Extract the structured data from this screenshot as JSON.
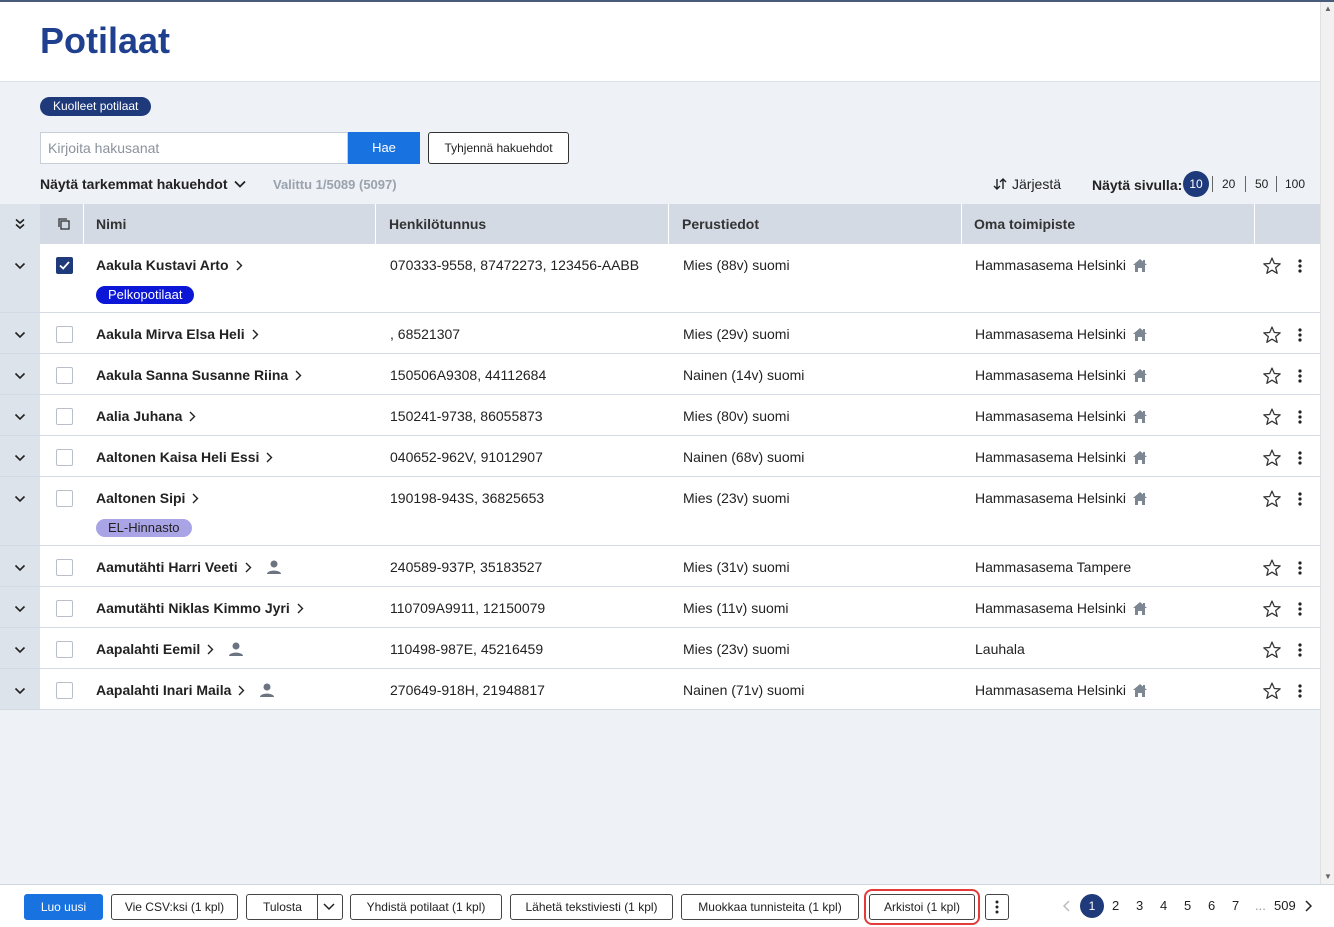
{
  "page": {
    "title": "Potilaat"
  },
  "filters": {
    "deceased_chip": "Kuolleet potilaat",
    "search_placeholder": "Kirjoita hakusanat",
    "search_button": "Hae",
    "clear_button": "Tyhjennä hakuehdot",
    "advanced_toggle": "Näytä tarkemmat hakuehdot",
    "selected_count": "Valittu 1/5089 (5097)",
    "sort_label": "Järjestä",
    "per_page_label": "Näytä sivulla:",
    "per_page_options": [
      "10",
      "20",
      "50",
      "100"
    ],
    "per_page_selected": "10"
  },
  "table": {
    "columns": [
      "Nimi",
      "Henkilötunnus",
      "Perustiedot",
      "Oma toimipiste"
    ],
    "rows": [
      {
        "name": "Aakula Kustavi Arto",
        "hetu": "070333-9558, 87472273, 123456-AABB",
        "basic": "Mies (88v) suomi",
        "office": "Hammasasema Helsinki",
        "tag": "Pelkopotilaat",
        "checked": true
      },
      {
        "name": "Aakula Mirva Elsa Heli",
        "hetu": ", 68521307",
        "basic": "Mies (29v) suomi",
        "office": "Hammasasema Helsinki"
      },
      {
        "name": "Aakula Sanna Susanne Riina",
        "hetu": "150506A9308, 44112684",
        "basic": "Nainen (14v) suomi",
        "office": "Hammasasema Helsinki"
      },
      {
        "name": "Aalia Juhana",
        "hetu": "150241-9738, 86055873",
        "basic": "Mies (80v) suomi",
        "office": "Hammasasema Helsinki"
      },
      {
        "name": "Aaltonen Kaisa Heli Essi",
        "hetu": "040652-962V, 91012907",
        "basic": "Nainen (68v) suomi",
        "office": "Hammasasema Helsinki"
      },
      {
        "name": "Aaltonen Sipi",
        "hetu": "190198-943S, 36825653",
        "basic": "Mies (23v) suomi",
        "office": "Hammasasema Helsinki",
        "tag": "EL-Hinnasto"
      },
      {
        "name": "Aamutähti Harri Veeti",
        "hetu": "240589-937P, 35183527",
        "basic": "Mies (31v) suomi",
        "office": "Hammasasema Tampere"
      },
      {
        "name": "Aamutähti Niklas Kimmo Jyri",
        "hetu": "110709A9911, 12150079",
        "basic": "Mies (11v) suomi",
        "office": "Hammasasema Helsinki"
      },
      {
        "name": "Aapalahti Eemil",
        "hetu": "110498-987E, 45216459",
        "basic": "Mies (23v) suomi",
        "office": "Lauhala"
      },
      {
        "name": "Aapalahti Inari Maila",
        "hetu": "270649-918H, 21948817",
        "basic": "Nainen (71v) suomi",
        "office": "Hammasasema Helsinki"
      }
    ]
  },
  "footer": {
    "create": "Luo uusi",
    "export_csv": "Vie CSV:ksi (1 kpl)",
    "print": "Tulosta",
    "merge": "Yhdistä potilaat (1 kpl)",
    "sms": "Lähetä tekstiviesti (1 kpl)",
    "edit_tags": "Muokkaa tunnisteita (1 kpl)",
    "archive": "Arkistoi (1 kpl)",
    "pages": [
      "1",
      "2",
      "3",
      "4",
      "5",
      "6",
      "7"
    ],
    "ellipsis": "...",
    "last_page": "509"
  },
  "colors": {
    "primary": "#1872e0",
    "navy": "#1f3a7a",
    "title": "#1f3f8f",
    "highlight": "#e53a3a"
  }
}
